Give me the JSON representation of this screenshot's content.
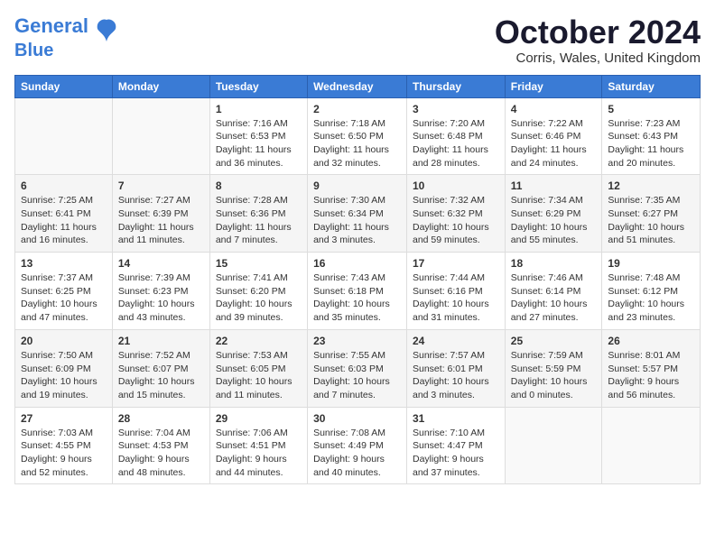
{
  "logo": {
    "general": "General",
    "blue": "Blue"
  },
  "title": "October 2024",
  "location": "Corris, Wales, United Kingdom",
  "days_of_week": [
    "Sunday",
    "Monday",
    "Tuesday",
    "Wednesday",
    "Thursday",
    "Friday",
    "Saturday"
  ],
  "weeks": [
    [
      {
        "day": "",
        "info": ""
      },
      {
        "day": "",
        "info": ""
      },
      {
        "day": "1",
        "info": "Sunrise: 7:16 AM\nSunset: 6:53 PM\nDaylight: 11 hours and 36 minutes."
      },
      {
        "day": "2",
        "info": "Sunrise: 7:18 AM\nSunset: 6:50 PM\nDaylight: 11 hours and 32 minutes."
      },
      {
        "day": "3",
        "info": "Sunrise: 7:20 AM\nSunset: 6:48 PM\nDaylight: 11 hours and 28 minutes."
      },
      {
        "day": "4",
        "info": "Sunrise: 7:22 AM\nSunset: 6:46 PM\nDaylight: 11 hours and 24 minutes."
      },
      {
        "day": "5",
        "info": "Sunrise: 7:23 AM\nSunset: 6:43 PM\nDaylight: 11 hours and 20 minutes."
      }
    ],
    [
      {
        "day": "6",
        "info": "Sunrise: 7:25 AM\nSunset: 6:41 PM\nDaylight: 11 hours and 16 minutes."
      },
      {
        "day": "7",
        "info": "Sunrise: 7:27 AM\nSunset: 6:39 PM\nDaylight: 11 hours and 11 minutes."
      },
      {
        "day": "8",
        "info": "Sunrise: 7:28 AM\nSunset: 6:36 PM\nDaylight: 11 hours and 7 minutes."
      },
      {
        "day": "9",
        "info": "Sunrise: 7:30 AM\nSunset: 6:34 PM\nDaylight: 11 hours and 3 minutes."
      },
      {
        "day": "10",
        "info": "Sunrise: 7:32 AM\nSunset: 6:32 PM\nDaylight: 10 hours and 59 minutes."
      },
      {
        "day": "11",
        "info": "Sunrise: 7:34 AM\nSunset: 6:29 PM\nDaylight: 10 hours and 55 minutes."
      },
      {
        "day": "12",
        "info": "Sunrise: 7:35 AM\nSunset: 6:27 PM\nDaylight: 10 hours and 51 minutes."
      }
    ],
    [
      {
        "day": "13",
        "info": "Sunrise: 7:37 AM\nSunset: 6:25 PM\nDaylight: 10 hours and 47 minutes."
      },
      {
        "day": "14",
        "info": "Sunrise: 7:39 AM\nSunset: 6:23 PM\nDaylight: 10 hours and 43 minutes."
      },
      {
        "day": "15",
        "info": "Sunrise: 7:41 AM\nSunset: 6:20 PM\nDaylight: 10 hours and 39 minutes."
      },
      {
        "day": "16",
        "info": "Sunrise: 7:43 AM\nSunset: 6:18 PM\nDaylight: 10 hours and 35 minutes."
      },
      {
        "day": "17",
        "info": "Sunrise: 7:44 AM\nSunset: 6:16 PM\nDaylight: 10 hours and 31 minutes."
      },
      {
        "day": "18",
        "info": "Sunrise: 7:46 AM\nSunset: 6:14 PM\nDaylight: 10 hours and 27 minutes."
      },
      {
        "day": "19",
        "info": "Sunrise: 7:48 AM\nSunset: 6:12 PM\nDaylight: 10 hours and 23 minutes."
      }
    ],
    [
      {
        "day": "20",
        "info": "Sunrise: 7:50 AM\nSunset: 6:09 PM\nDaylight: 10 hours and 19 minutes."
      },
      {
        "day": "21",
        "info": "Sunrise: 7:52 AM\nSunset: 6:07 PM\nDaylight: 10 hours and 15 minutes."
      },
      {
        "day": "22",
        "info": "Sunrise: 7:53 AM\nSunset: 6:05 PM\nDaylight: 10 hours and 11 minutes."
      },
      {
        "day": "23",
        "info": "Sunrise: 7:55 AM\nSunset: 6:03 PM\nDaylight: 10 hours and 7 minutes."
      },
      {
        "day": "24",
        "info": "Sunrise: 7:57 AM\nSunset: 6:01 PM\nDaylight: 10 hours and 3 minutes."
      },
      {
        "day": "25",
        "info": "Sunrise: 7:59 AM\nSunset: 5:59 PM\nDaylight: 10 hours and 0 minutes."
      },
      {
        "day": "26",
        "info": "Sunrise: 8:01 AM\nSunset: 5:57 PM\nDaylight: 9 hours and 56 minutes."
      }
    ],
    [
      {
        "day": "27",
        "info": "Sunrise: 7:03 AM\nSunset: 4:55 PM\nDaylight: 9 hours and 52 minutes."
      },
      {
        "day": "28",
        "info": "Sunrise: 7:04 AM\nSunset: 4:53 PM\nDaylight: 9 hours and 48 minutes."
      },
      {
        "day": "29",
        "info": "Sunrise: 7:06 AM\nSunset: 4:51 PM\nDaylight: 9 hours and 44 minutes."
      },
      {
        "day": "30",
        "info": "Sunrise: 7:08 AM\nSunset: 4:49 PM\nDaylight: 9 hours and 40 minutes."
      },
      {
        "day": "31",
        "info": "Sunrise: 7:10 AM\nSunset: 4:47 PM\nDaylight: 9 hours and 37 minutes."
      },
      {
        "day": "",
        "info": ""
      },
      {
        "day": "",
        "info": ""
      }
    ]
  ]
}
